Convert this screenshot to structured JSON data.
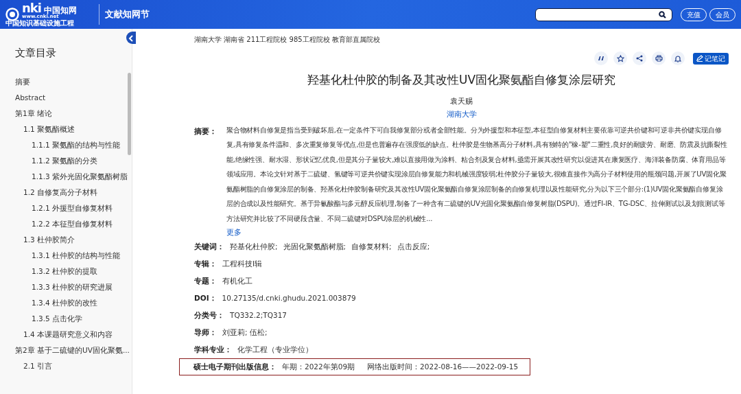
{
  "header": {
    "logo": {
      "mark": "nki",
      "cn": "中国知网",
      "url": "www.cnki.net",
      "tagline": "中国知识基础设施工程"
    },
    "section": "文献知网节",
    "buttons": [
      "充值",
      "会员"
    ]
  },
  "sidebar": {
    "title": "文章目录",
    "items": [
      {
        "label": "摘要"
      },
      {
        "label": "Abstract"
      },
      {
        "label": "第1章 绪论",
        "children": [
          {
            "label": "1.1 聚氨酯概述",
            "children": [
              {
                "label": "1.1.1 聚氨酯的结构与性能"
              },
              {
                "label": "1.1.2 聚氨酯的分类"
              },
              {
                "label": "1.1.3 紫外光固化聚氨酯树脂"
              }
            ]
          },
          {
            "label": "1.2 自修复高分子材料",
            "children": [
              {
                "label": "1.2.1 外援型自修复材料"
              },
              {
                "label": "1.2.2 本征型自修复材料"
              }
            ]
          },
          {
            "label": "1.3 杜仲胶简介",
            "children": [
              {
                "label": "1.3.1 杜仲胶的结构与性能"
              },
              {
                "label": "1.3.2 杜仲胶的提取"
              },
              {
                "label": "1.3.3 杜仲胶的研究进展"
              },
              {
                "label": "1.3.4 杜仲胶的改性"
              },
              {
                "label": "1.3.5 点击化学"
              }
            ]
          },
          {
            "label": "1.4 本课题研究意义和内容"
          }
        ]
      },
      {
        "label": "第2章 基于二硫键的UV固化聚氨...",
        "children": [
          {
            "label": "2.1 引言"
          }
        ]
      }
    ]
  },
  "article": {
    "institution": "湖南大学  湖南省 211工程院校 985工程院校 教育部直属院校",
    "note_button": "记笔记",
    "title": "羟基化杜仲胶的制备及其改性UV固化聚氨酯自修复涂层研究",
    "author": "袁天赐",
    "affiliation": "湖南大学",
    "abstract_label": "摘要：",
    "abstract": "聚合物材料自修复是指当受到破坏后,在一定条件下可自我修复部分或者全部性能。分为外援型和本征型,本征型自修复材料主要依靠可逆共价键和可逆非共价键实现自修复,具有修复条件温和、多次重复修复等优点,但是也普遍存在强度低的缺点。杜仲胶是生物基高分子材料,具有独特的\"橡-塑\"二重性,良好的耐疲劳、耐磨、防震及抗撕裂性能,绝缘性强、耐水湿、形状记忆优良,但是其分子量较大,难以直接用做为涂料、粘合剂及复合材料,亟需开展其改性研究以促进其在康复医疗、海洋装备防腐、体育用品等领域应用。本论文针对基于二硫键、氢键等可逆共价键实现涂层自修复能力和机械强度较弱;杜仲胶分子量较大,很难直接作为高分子材料使用的瓶颈问题,开展了UV固化聚氨酯树脂的自修复涂层的制备、羟基化杜仲胶制备研究及其改性UV固化聚氨酯自修复涂层制备的自修复机理以及性能研究,分为以下三个部分:(1)UV固化聚氨酯自修复涂层的合成以及性能研究。基于异氰酸酯与多元醇反应机理,制备了一种含有二硫键的UV光固化聚氨酯自修复树脂(DSPU)。通过FI-IR、TG-DSC、拉伸测试以及划痕测试等方法研究并比较了不同硬段含量、不同二硫键对DSPU涂层的机械性...",
    "more": "更多",
    "fields": [
      {
        "label": "关键词：",
        "values": [
          "羟基化杜仲胶;",
          "光固化聚氨酯树脂;",
          "自修复材料;",
          "点击反应;"
        ],
        "highlighted": false
      },
      {
        "label": "专辑：",
        "values": [
          "工程科技Ⅰ辑"
        ],
        "highlighted": false
      },
      {
        "label": "专题：",
        "values": [
          "有机化工"
        ],
        "highlighted": false
      },
      {
        "label": "DOI：",
        "values": [
          "10.27135/d.cnki.ghudu.2021.003879"
        ],
        "highlighted": false
      },
      {
        "label": "分类号：",
        "values": [
          "TQ332.2;TQ317"
        ],
        "highlighted": false
      },
      {
        "label": "导师：",
        "values": [
          "刘亚莉; 伍松;"
        ],
        "highlighted": false
      },
      {
        "label": "学科专业：",
        "values": [
          "化学工程（专业学位）"
        ],
        "highlighted": false
      },
      {
        "label": "硕士电子期刊出版信息：",
        "values": [
          "年期：2022年第09期",
          "网络出版时间：2022-08-16——2022-09-15"
        ],
        "highlighted": true
      }
    ]
  }
}
